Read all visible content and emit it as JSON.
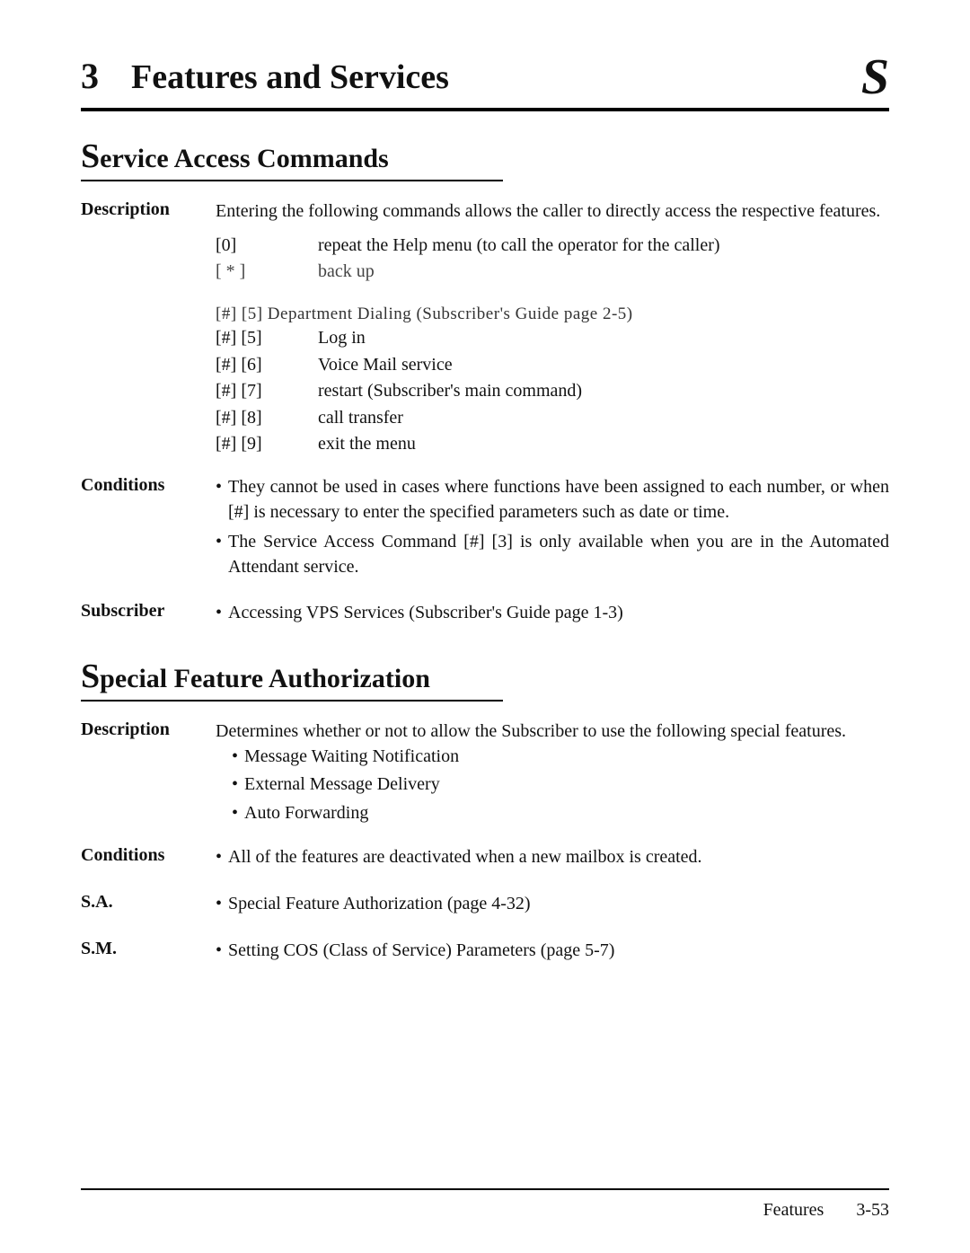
{
  "chapter": {
    "num": "3",
    "title": "Features and Services",
    "icon": "S"
  },
  "sac": {
    "title_big": "S",
    "title_rest": "ervice Access Commands",
    "description": {
      "label": "Description",
      "text": "Entering the following commands allows the caller to directly access the respective features.",
      "lines": [
        {
          "key": "[0]",
          "desc": "repeat the Help menu (to call the operator for the caller)"
        },
        {
          "key": "[ * ]",
          "desc": "back up"
        }
      ]
    },
    "subscriber_block": {
      "label_artifact": "",
      "top_artifact": "[#] [5]    Department Dialing (Subscriber's Guide page 2-5)",
      "lines": [
        {
          "key": "[#] [5]",
          "desc": "Log in"
        },
        {
          "key": "[#] [6]",
          "desc": "Voice Mail service"
        },
        {
          "key": "[#] [7]",
          "desc": "restart (Subscriber's main command)"
        },
        {
          "key": "[#] [8]",
          "desc": "call transfer"
        },
        {
          "key": "[#] [9]",
          "desc": "exit the menu"
        }
      ]
    },
    "conditions": {
      "label": "Conditions",
      "bullets": [
        "They cannot be used in cases where functions have been assigned to each number, or when [#] is necessary to enter the specified parameters such as date or time.",
        "The Service Access Command [#] [3] is only available when you are in the Automated Attendant service."
      ]
    },
    "subscriber_ref": {
      "label": "Subscriber",
      "text": "Accessing VPS Services (Subscriber's Guide page 1-3)"
    }
  },
  "sfa": {
    "title_big": "S",
    "title_rest": "pecial Feature Authorization",
    "description": {
      "label": "Description",
      "text": "Determines whether or not to allow the Subscriber to use the following special features.",
      "bullets": [
        "Message Waiting Notification",
        "External Message Delivery",
        "Auto Forwarding"
      ]
    },
    "conditions": {
      "label": "Conditions",
      "text": "All of the features are deactivated when a new mailbox is created."
    },
    "sa": {
      "label": "S.A.",
      "text": "Special Feature Authorization (page 4-32)"
    },
    "sm": {
      "label": "S.M.",
      "text": "Setting COS (Class of Service) Parameters (page 5-7)"
    }
  },
  "footer": {
    "left": "Features",
    "right": "3-53"
  }
}
